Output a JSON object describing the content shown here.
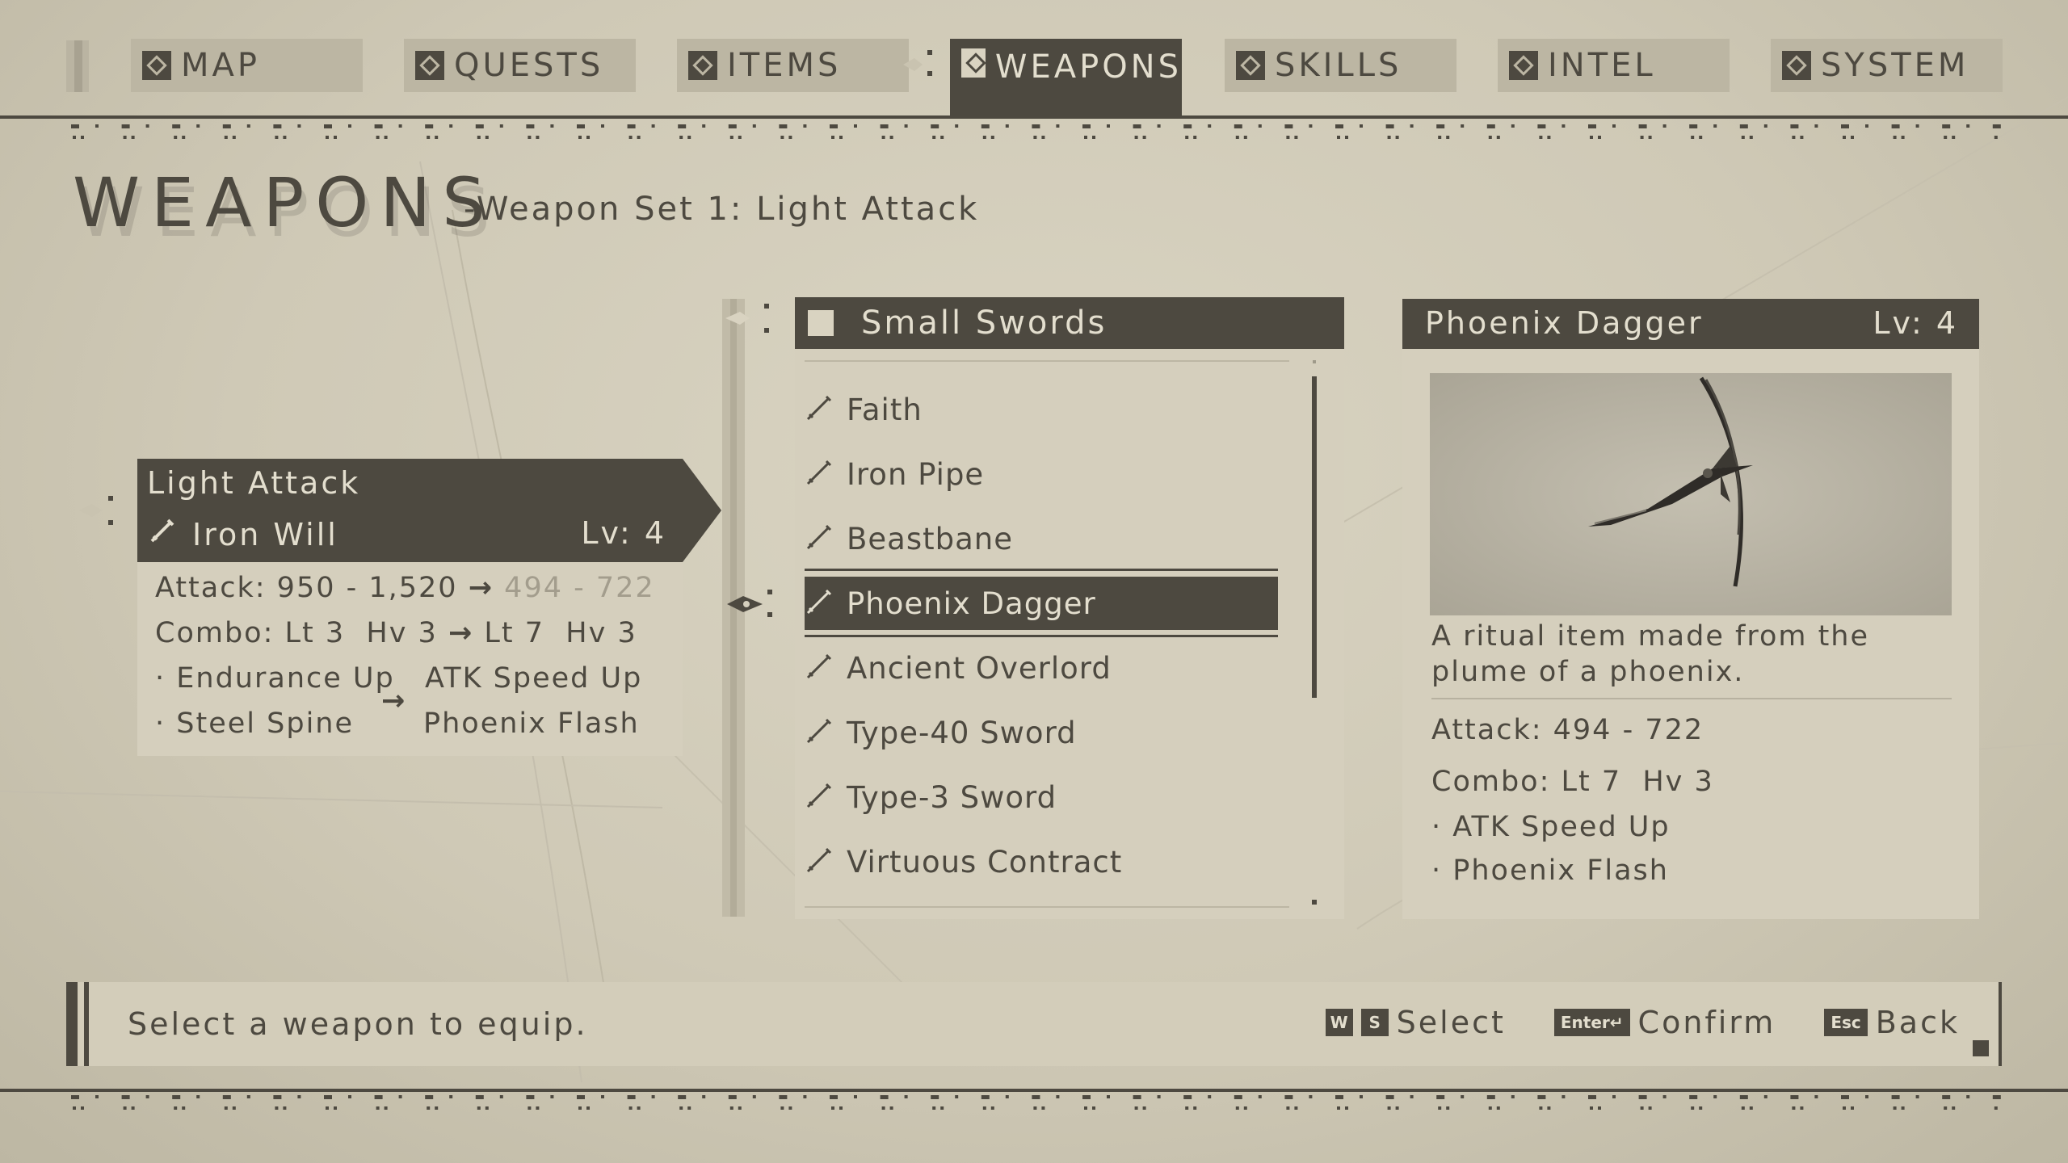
{
  "nav": {
    "tabs": [
      {
        "label": "MAP",
        "icon": "map-icon",
        "active": false
      },
      {
        "label": "QUESTS",
        "icon": "quests-icon",
        "active": false
      },
      {
        "label": "ITEMS",
        "icon": "items-icon",
        "active": false
      },
      {
        "label": "WEAPONS",
        "icon": "weapons-icon",
        "active": true
      },
      {
        "label": "SKILLS",
        "icon": "skills-icon",
        "active": false
      },
      {
        "label": "INTEL",
        "icon": "intel-icon",
        "active": false
      },
      {
        "label": "SYSTEM",
        "icon": "system-icon",
        "active": false
      }
    ]
  },
  "page": {
    "title": "WEAPONS",
    "subtitle": "-Weapon Set 1: Light Attack"
  },
  "current": {
    "slot": "Light Attack",
    "weapon": "Iron Will",
    "level": "Lv: 4",
    "attack_label": "Attack:",
    "attack_current": "950 - 1,520",
    "attack_new": "494 - 722",
    "combo_label": "Combo:",
    "combo_current": "Lt 3  Hv 3",
    "combo_new": "Lt 7  Hv 3",
    "abilities_current": [
      "Endurance Up",
      "Steel Spine"
    ],
    "abilities_new": [
      "ATK Speed Up",
      "Phoenix Flash"
    ]
  },
  "list": {
    "category": "Small Swords",
    "items": [
      "Faith",
      "Iron Pipe",
      "Beastbane",
      "Phoenix Dagger",
      "Ancient Overlord",
      "Type-40 Sword",
      "Type-3 Sword",
      "Virtuous Contract"
    ],
    "selected_index": 3
  },
  "detail": {
    "name": "Phoenix Dagger",
    "level": "Lv: 4",
    "description": "A ritual item made from the plume of a phoenix.",
    "attack": "Attack: 494 - 722",
    "combo": "Combo: Lt 7  Hv 3",
    "abilities": [
      "ATK Speed Up",
      "Phoenix Flash"
    ]
  },
  "footer": {
    "help": "Select a weapon to equip.",
    "keys": {
      "w": "W",
      "s": "S",
      "enter": "Enter↵",
      "esc": "Esc"
    },
    "select_label": "Select",
    "confirm_label": "Confirm",
    "back_label": "Back"
  },
  "colors": {
    "background": "#cfc9b6",
    "dark": "#4d4940",
    "light_text": "#e3dece",
    "panel": "#d5cfbd",
    "faded": "#a39d8d"
  }
}
